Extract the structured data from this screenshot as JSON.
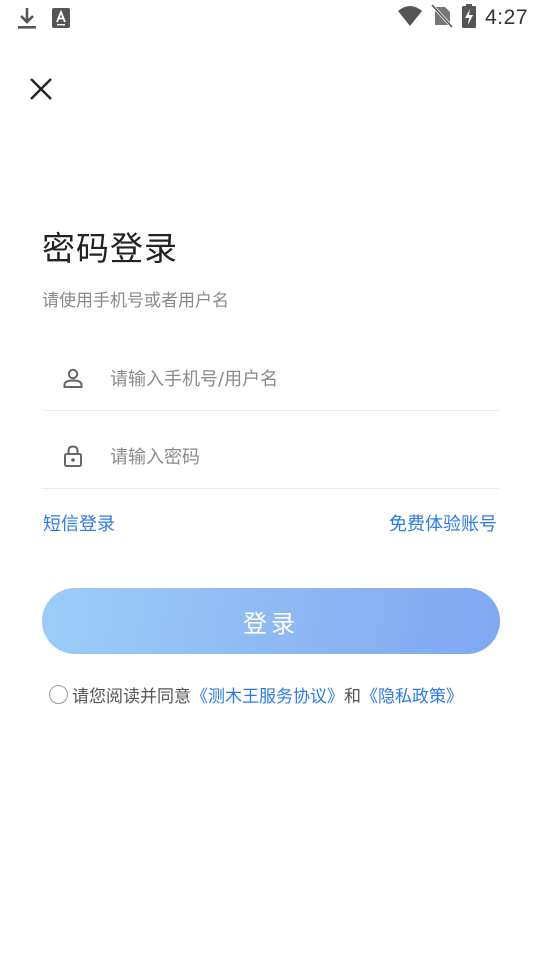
{
  "status_bar": {
    "time": "4:27",
    "icons": [
      "download-icon",
      "text-notification-icon",
      "wifi-icon",
      "no-sim-icon",
      "battery-charging-icon"
    ]
  },
  "header": {
    "close_icon": "close-icon"
  },
  "login": {
    "title": "密码登录",
    "subtitle": "请使用手机号或者用户名",
    "username": {
      "icon": "user-icon",
      "placeholder": "请输入手机号/用户名",
      "value": ""
    },
    "password": {
      "icon": "lock-icon",
      "placeholder": "请输入密码",
      "value": ""
    },
    "sms_login_label": "短信登录",
    "trial_account_label": "免费体验账号",
    "submit_label": "登录"
  },
  "agreement": {
    "checked": false,
    "prefix": "请您阅读并同意",
    "service_link": "《测木王服务协议》",
    "and": "和",
    "privacy_link": "《隐私政策》"
  },
  "colors": {
    "accent": "#2c7be5",
    "button_gradient_start": "#9bcdf8",
    "button_gradient_end": "#7fa8f2",
    "title": "#222222",
    "muted": "#8a8a8a"
  }
}
